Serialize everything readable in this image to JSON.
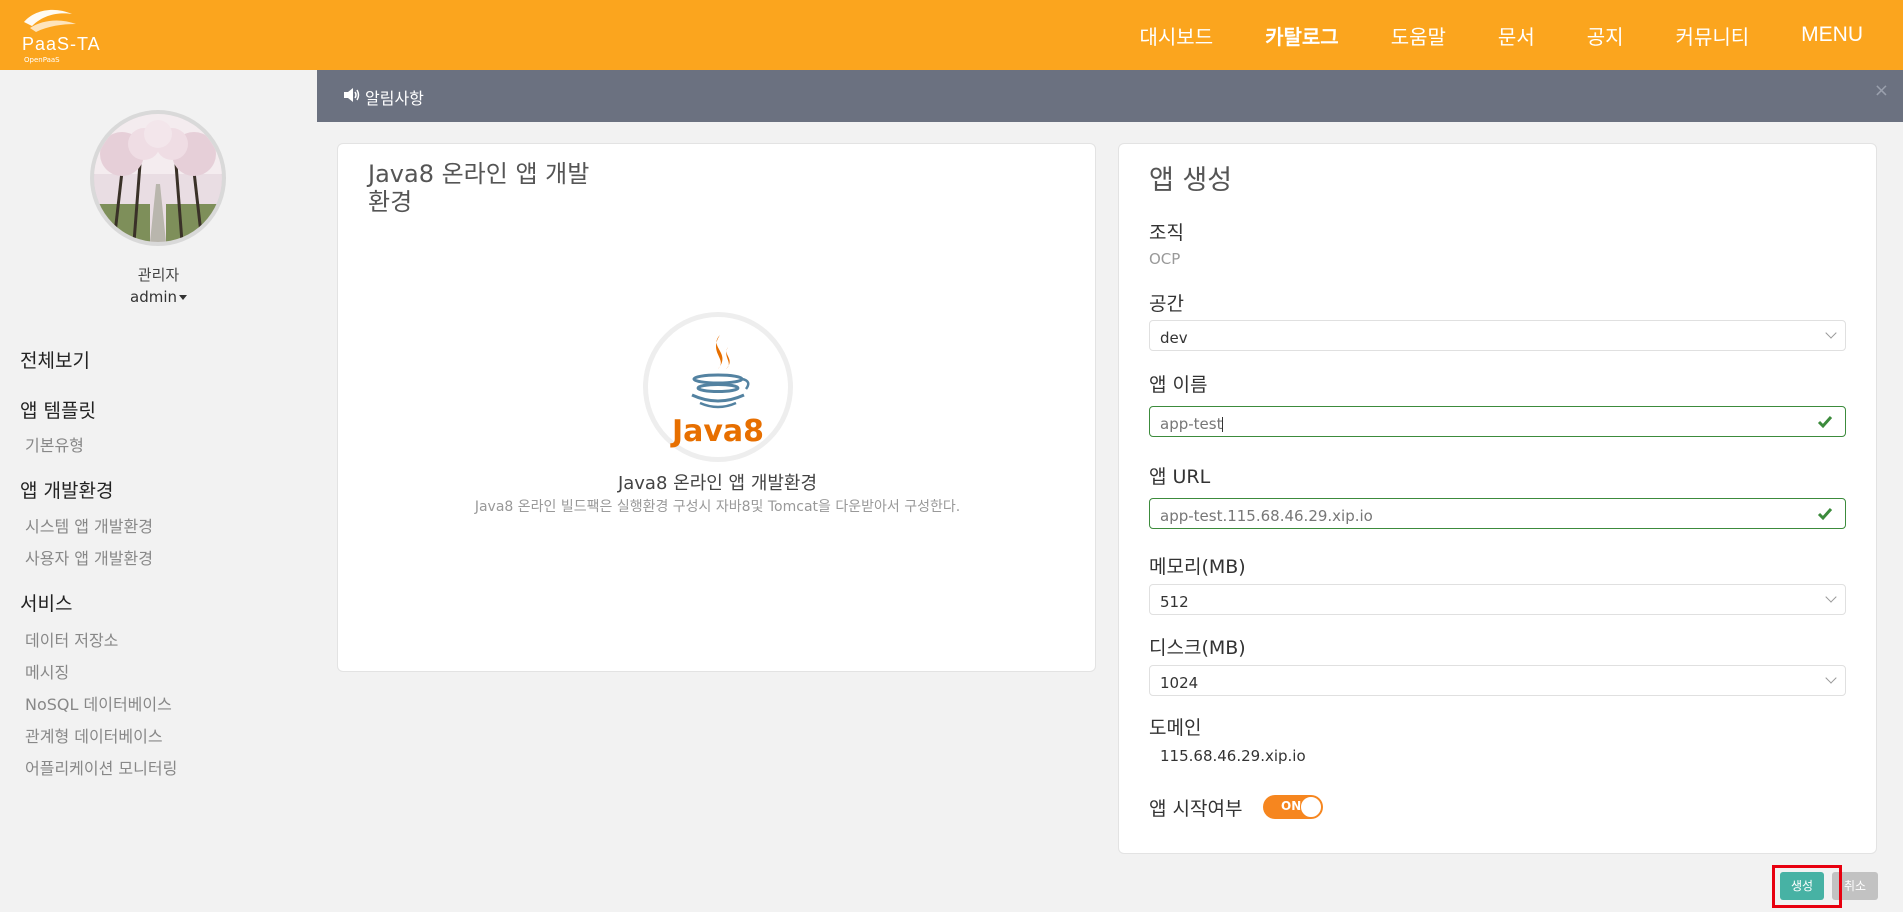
{
  "header": {
    "logo_text": "PaaS-TA",
    "logo_sub": "OpenPaaS",
    "nav": [
      "대시보드",
      "카탈로그",
      "도움말",
      "문서",
      "공지",
      "커뮤니티"
    ],
    "menu_label": "MENU",
    "active_nav": "카탈로그",
    "brand_color": "#fba51e"
  },
  "sidebar": {
    "user_role": "관리자",
    "user_id": "admin",
    "sections": [
      {
        "label": "전체보기",
        "items": []
      },
      {
        "label": "앱 템플릿",
        "items": [
          "기본유형"
        ]
      },
      {
        "label": "앱 개발환경",
        "items": [
          "시스템 앱 개발환경",
          "사용자 앱 개발환경"
        ]
      },
      {
        "label": "서비스",
        "items": [
          "데이터 저장소",
          "메시징",
          "NoSQL 데이터베이스",
          "관계형 데이터베이스",
          "어플리케이션 모니터링"
        ]
      }
    ]
  },
  "notice": {
    "label": "알림사항",
    "close": "×"
  },
  "left_panel": {
    "title": "Java8 온라인 앱 개발환경",
    "logo_text": "Java8",
    "name": "Java8 온라인 앱 개발환경",
    "description": "Java8 온라인 빌드팩은 실행환경 구성시 자바8및 Tomcat을 다운받아서 구성한다."
  },
  "right_panel": {
    "title": "앱 생성",
    "org_label": "조직",
    "org_value": "OCP",
    "space_label": "공간",
    "space_value": "dev",
    "app_name_label": "앱 이름",
    "app_name_value": "app-test",
    "app_url_label": "앱 URL",
    "app_url_value": "app-test.115.68.46.29.xip.io",
    "memory_label": "메모리(MB)",
    "memory_value": "512",
    "disk_label": "디스크(MB)",
    "disk_value": "1024",
    "domain_label": "도메인",
    "domain_value": "115.68.46.29.xip.io",
    "start_label": "앱 시작여부",
    "start_toggle": "ON",
    "start_on": true
  },
  "actions": {
    "create": "생성",
    "cancel": "취소"
  }
}
